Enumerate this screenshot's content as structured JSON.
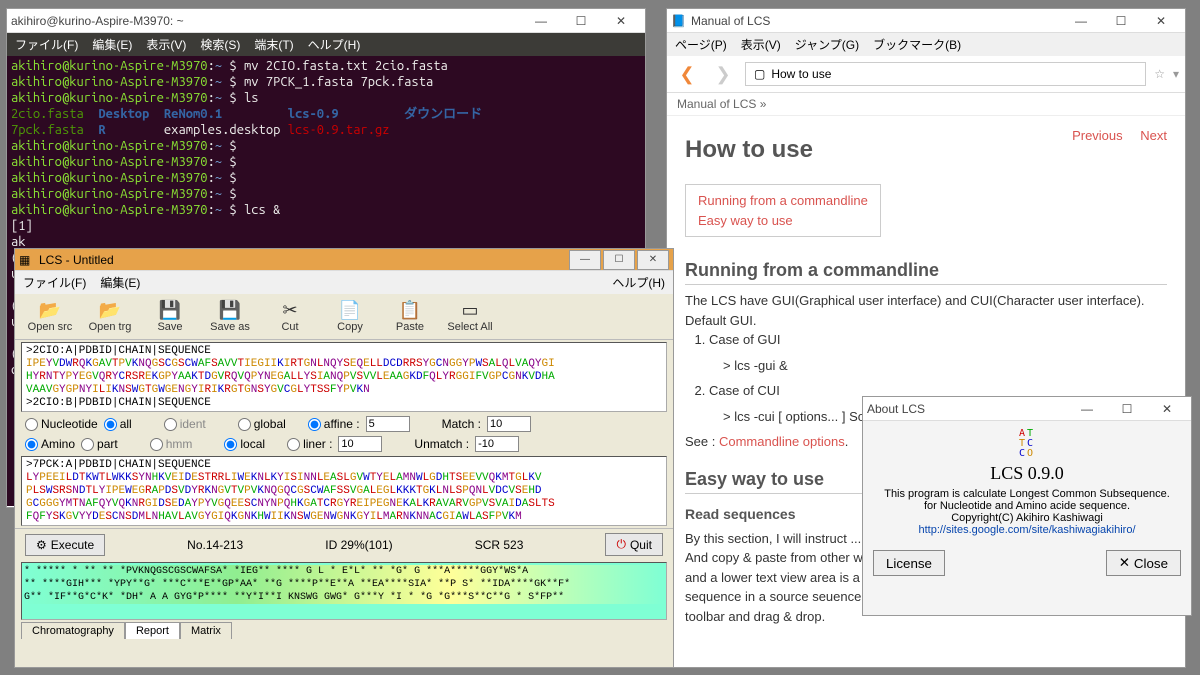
{
  "terminal": {
    "title": "akihiro@kurino-Aspire-M3970: ~",
    "menus": [
      "ファイル(F)",
      "編集(E)",
      "表示(V)",
      "検索(S)",
      "端末(T)",
      "ヘルプ(H)"
    ],
    "lines": [
      {
        "prompt": "akihiro@kurino-Aspire-M3970",
        "path": "~",
        "cmd": "mv 2CIO.fasta.txt 2cio.fasta"
      },
      {
        "prompt": "akihiro@kurino-Aspire-M3970",
        "path": "~",
        "cmd": "mv 7PCK_1.fasta 7pck.fasta"
      },
      {
        "prompt": "akihiro@kurino-Aspire-M3970",
        "path": "~",
        "cmd": "ls"
      }
    ],
    "ls_row1": [
      {
        "t": "2cio.fasta",
        "c": "green"
      },
      {
        "t": "Desktop",
        "c": "blue"
      },
      {
        "t": "ReNom0.1",
        "c": "blue"
      },
      {
        "t": "lcs-0.9",
        "c": "blue"
      },
      {
        "t": "ダウンロード",
        "c": "blue"
      }
    ],
    "ls_row2": [
      {
        "t": "7pck.fasta",
        "c": "green"
      },
      {
        "t": "R",
        "c": "blue"
      },
      {
        "t": "examples.desktop",
        "c": "cmd"
      },
      {
        "t": "lcs-0.9.tar.gz",
        "c": "red"
      }
    ],
    "empties": 4,
    "lastcmd": "lcs &",
    "job": "[1]"
  },
  "lcs": {
    "title": "LCS - Untitled",
    "menus_left": [
      "ファイル(F)",
      "編集(E)"
    ],
    "menus_right": "ヘルプ(H)",
    "toolbar": [
      "Open src",
      "Open trg",
      "Save",
      "Save as",
      "Cut",
      "Copy",
      "Paste",
      "Select All"
    ],
    "seq1_header": ">2CIO:A|PDBID|CHAIN|SEQUENCE",
    "seq1_lines": [
      "IPEYVDWRQKGAVTPVKNQGSCGSCWAFSAVVTIEGIIKIRTGNLNQYSEQELLDCDRRSYGCNGGYPWSALQLVAQYGI",
      "HYRNTYPYEGVQRYCRSREKGPYAAKTDGVRQVQPYNEGALLYSIANQPVSVVLEAAGKDFQLYRGGIFVGPCGNKVDHA",
      "VAAVGYGPNYILIKNSWGTGWGENGYIRIKRGTGNSYGVCGLYTSSFYPVKN"
    ],
    "seq1_header2": ">2CIO:B|PDBID|CHAIN|SEQUENCE",
    "radios": {
      "nucleotide": "Nucleotide",
      "all": "all",
      "ident": "ident",
      "global": "global",
      "affine": "affine :",
      "amino": "Amino",
      "part": "part",
      "hmm": "hmm",
      "local": "local",
      "liner": "liner :"
    },
    "affine_val": "5",
    "liner_val": "10",
    "match_lbl": "Match :",
    "match_val": "10",
    "unmatch_lbl": "Unmatch :",
    "unmatch_val": "-10",
    "seq2_header": ">7PCK:A|PDBID|CHAIN|SEQUENCE",
    "seq2_lines": [
      "LYPEEILDTKWTLWKKSYNHKVEIDESTRRLIWEKNLKYISINNLEASLGVWTYELAMNWLGDHTSEEVVQKMTGLKV",
      "PLSWSRSNDTLYIPEWEGRAPDSVDYRKNGVTVPVKNQGQCGSCWAFSSVGALEGLKKKTGKLNLSPQNLVDCVSEHD",
      "GCGGGYMTNAFQYVQKNRGIDSEDAYPYVGQEESCNYNPQHKGATCRGYREIPEGNEKALKRAVARVGPVSVAIDASLTS",
      "FQFYSKGVYYDESCNSDMLNHAVLAVGYGIQKGNKHWIIKNSWGENWGNKGYILMARNKNNACGIAWLASFPVKM"
    ],
    "execute": "Execute",
    "quit": "Quit",
    "status_no": "No.14-213",
    "status_id": "ID 29%(101)",
    "status_scr": "SCR 523",
    "tabs": [
      "Chromatography",
      "Report",
      "Matrix"
    ]
  },
  "help": {
    "title": "Manual of LCS",
    "menus": [
      "ページ(P)",
      "表示(V)",
      "ジャンプ(G)",
      "ブックマーク(B)"
    ],
    "loc": "How to use",
    "crumb": "Manual of LCS »",
    "h1": "How to use",
    "prev": "Previous",
    "next": "Next",
    "box": [
      "Running from a commandline",
      "Easy way to use"
    ],
    "sec1_h": "Running from a commandline",
    "sec1_p": "The LCS have GUI(Graphical user interface) and CUI(Character user interface). Default GUI.",
    "li1": "Case of GUI",
    "cmd1": "> lcs -gui &",
    "li2": "Case of CUI",
    "cmd2": "> lcs -cui [ options... ] Source",
    "see": "See : ",
    "see_link": "Commandline options",
    "sec2_h": "Easy way to use",
    "read_h": "Read sequences",
    "read_p": "By this section, I will instruct ... user interface of a standard GUI ... sequence file. And copy & paste from other window. A upper text view area is a source data area, and a lower text view area is a target data area. A source data mean find a target sequence in a source seuence. I designed for copy & paste. But you can use menu, toolbar and drag & drop."
  },
  "about": {
    "title": "About LCS",
    "name": "LCS 0.9.0",
    "desc1": "This program is calculate Longest Common Subsequence.",
    "desc2": "for Nucleotide and Amino acide sequence.",
    "copy": "Copyright(C) Akihiro Kashiwagi",
    "url": "http://sites.google.com/site/kashiwagiakihiro/",
    "license": "License",
    "close": "Close"
  }
}
